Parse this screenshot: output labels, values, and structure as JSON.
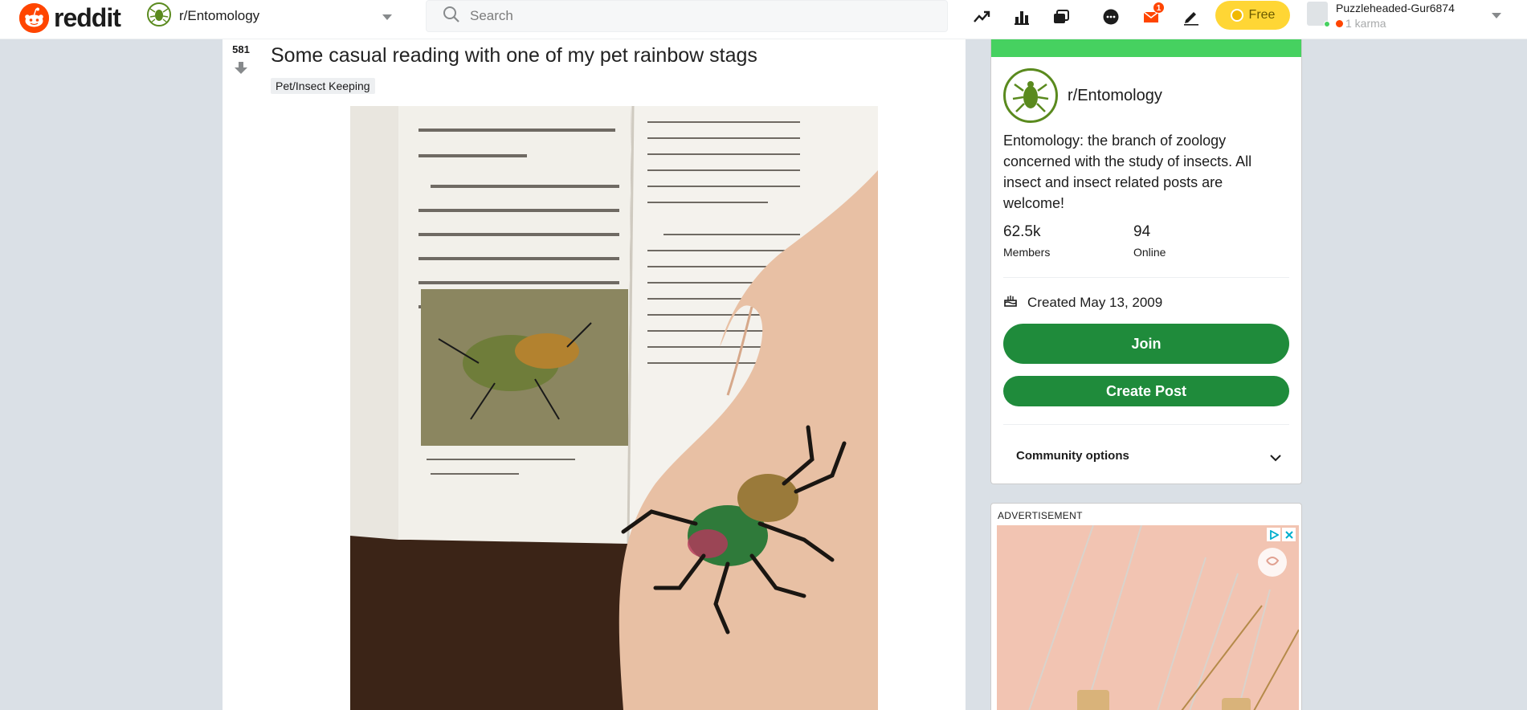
{
  "header": {
    "brand": "reddit",
    "community": "r/Entomology",
    "search_placeholder": "Search",
    "notification_count": "1",
    "premium_label": "Free",
    "username": "Puzzleheaded-Gur6874",
    "karma": "1 karma"
  },
  "post": {
    "score": "581",
    "title": "Some casual reading with one of my pet rainbow stags",
    "flair": "Pet/Insect Keeping"
  },
  "sidebar": {
    "community_name": "r/Entomology",
    "description": "Entomology: the branch of zoology concerned with the study of insects. All insect and insect related posts are welcome!",
    "members_value": "62.5k",
    "members_label": "Members",
    "online_value": "94",
    "online_label": "Online",
    "created": "Created May 13, 2009",
    "join_label": "Join",
    "create_post_label": "Create Post",
    "community_options_label": "Community options"
  },
  "ad": {
    "label": "ADVERTISEMENT"
  },
  "colors": {
    "brand_orange": "#ff4500",
    "join_green": "#1f8b3b",
    "banner_green": "#46d160",
    "premium_yellow": "#ffd635"
  }
}
